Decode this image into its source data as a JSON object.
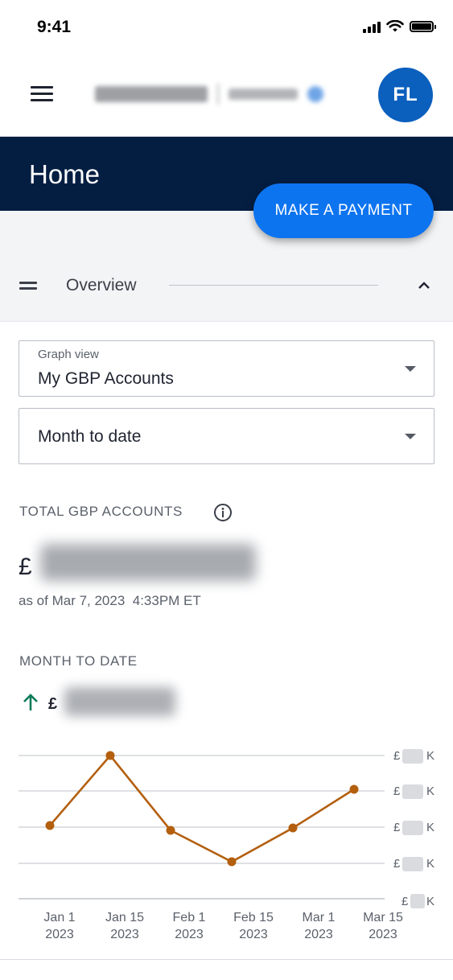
{
  "status_bar": {
    "time": "9:41",
    "icons": [
      "cellular-signal-icon",
      "wifi-icon",
      "battery-icon"
    ]
  },
  "header": {
    "menu_icon": "hamburger-menu-icon",
    "avatar_initials": "FL",
    "avatar_color": "#0b5fbd"
  },
  "title_band": {
    "title": "Home",
    "background": "#041e42"
  },
  "make_payment": {
    "label": "MAKE A PAYMENT",
    "color": "#0d74f0"
  },
  "overview": {
    "label": "Overview",
    "drag_icon": "drag-handle-icon",
    "collapse_icon": "chevron-up-icon"
  },
  "graph_view": {
    "label": "Graph view",
    "value": "My GBP Accounts"
  },
  "period": {
    "value": "Month to date"
  },
  "total": {
    "label": "TOTAL GBP ACCOUNTS",
    "currency": "£",
    "as_of": "as of Mar 7, 2023  4:33PM ET",
    "info_icon": "info-circle-icon"
  },
  "month_to_date": {
    "label": "MONTH TO DATE",
    "currency": "£",
    "trend_icon": "arrow-up-icon",
    "trend_color": "#0f7b5a"
  },
  "chart_data": {
    "type": "line",
    "x_labels": [
      [
        "Jan 1",
        "2023"
      ],
      [
        "Jan 15",
        "2023"
      ],
      [
        "Feb 1",
        "2023"
      ],
      [
        "Feb 15",
        "2023"
      ],
      [
        "Mar 1",
        "2023"
      ],
      [
        "Mar 15",
        "2023"
      ]
    ],
    "y_tick_labels": [
      "£",
      "£",
      "£",
      "£",
      "£"
    ],
    "y_tick_suffix": "K",
    "points_note": "values obscured",
    "series_color": "#b35f0e",
    "grid": true
  }
}
